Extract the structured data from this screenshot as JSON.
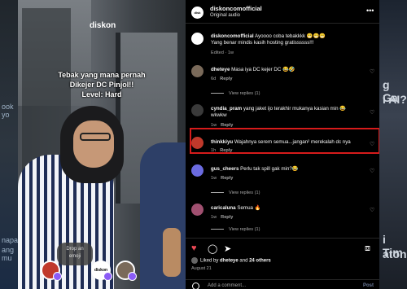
{
  "backdrop": {
    "right_text_1": "g Ga",
    "right_text_2": "i AI?",
    "right_text_3": "i Tim",
    "right_text_4": "aton",
    "left_text_1": "ook yo",
    "left_text_2": "napa",
    "left_text_3": "ang mu"
  },
  "reel": {
    "logo": "diskon",
    "caption_line1": "Tebak yang mana pernah",
    "caption_line2": "Dikejer DC Pinjol!!",
    "caption_line3": "Level: Hard",
    "drop_emoji_line1": "Drop an",
    "drop_emoji_line2": "emoji",
    "avatar_logo": "diskon"
  },
  "post": {
    "username": "diskoncomofficial",
    "subtitle": "Original audio",
    "more_icon": "•••",
    "caption_user": "diskoncomofficial",
    "caption_text": "Ayoooo coba tebakkkk 😁😁😁",
    "caption_line2": "Yang benar mindis kasih hosting gratissssss!!!",
    "caption_meta": "Edited · 1w"
  },
  "comments": [
    {
      "user": "dheteye",
      "text": "Masa iya DC kejer DC 😂🤣",
      "time": "6d",
      "reply": "Reply",
      "avatar_color": "#7a6a5a"
    },
    {
      "user": "cyndia_pram",
      "text": "yang jaket ijo terakhir mukanya kasian min 😂",
      "text2": "wkwkw",
      "time": "1w",
      "reply": "Reply",
      "avatar_color": "#3a3a3a"
    },
    {
      "user": "thinkkiyu",
      "text": "Wajahnya serem semua...jangan² merekalah dc nya",
      "time": "1h",
      "reply": "Reply",
      "avatar_color": "#c0392b"
    },
    {
      "user": "gus_cheers",
      "text": "Perlu tak spill gak min?😂",
      "time": "1w",
      "reply": "Reply",
      "avatar_color": "#6b6be0"
    },
    {
      "user": "caricaluna",
      "text": "Semua 🔥",
      "time": "1w",
      "reply": "Reply",
      "avatar_color": "#a05070"
    }
  ],
  "view_replies": "View replies (1)",
  "actions": {
    "like_icon": "♥",
    "comment_icon": "◯",
    "share_icon": "➤",
    "save_icon": "⧈"
  },
  "liked_by": {
    "prefix": "Liked by",
    "user": "dheteye",
    "and": "and",
    "others": "24 others"
  },
  "date": "August 21",
  "add_comment": {
    "placeholder": "Add a comment...",
    "post": "Post"
  },
  "colors": {
    "highlight": "#d61b1b",
    "like": "#ed4956"
  }
}
